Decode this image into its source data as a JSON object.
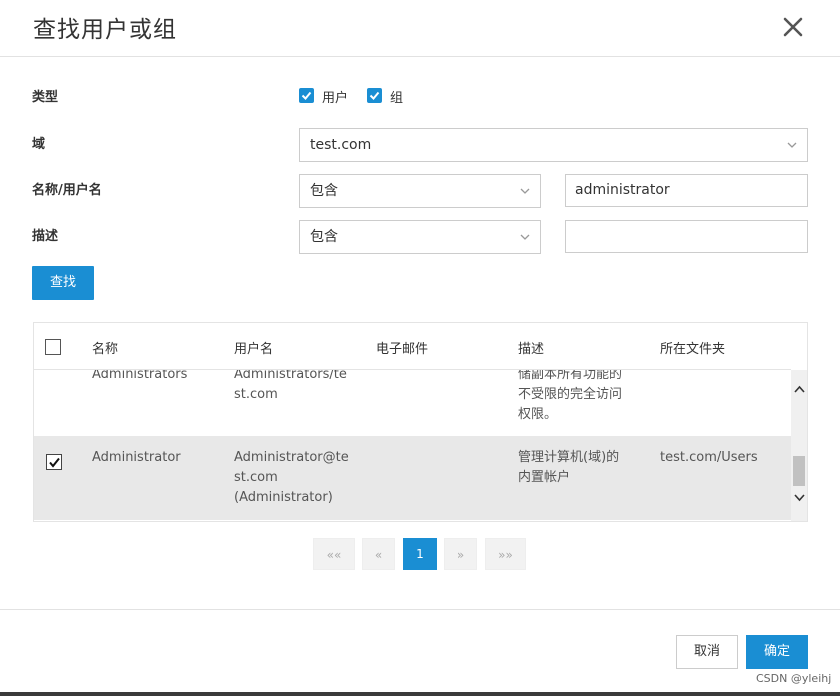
{
  "dialog": {
    "title": "查找用户或组"
  },
  "form": {
    "type_label": "类型",
    "type_options": [
      {
        "label": "用户",
        "checked": true
      },
      {
        "label": "组",
        "checked": true
      }
    ],
    "domain_label": "域",
    "domain_value": "test.com",
    "name_label": "名称/用户名",
    "name_operator": "包含",
    "name_value": "administrator",
    "desc_label": "描述",
    "desc_operator": "包含",
    "desc_value": "",
    "search_button": "查找"
  },
  "table": {
    "columns": [
      "名称",
      "用户名",
      "电子邮件",
      "描述",
      "所在文件夹"
    ],
    "rows": [
      {
        "checked": false,
        "name": "Administrators",
        "username": "Administrators/te\nst.com",
        "email": "",
        "description": "储副本所有功能的\n不受限的完全访问\n权限。",
        "folder": ""
      },
      {
        "checked": true,
        "name": "Administrator",
        "username": "Administrator@te\nst.com\n(Administrator)",
        "email": "",
        "description": "管理计算机(域)的\n内置帐户",
        "folder": "test.com/Users"
      }
    ]
  },
  "pagination": {
    "first": "««",
    "prev": "«",
    "current": "1",
    "next": "»",
    "last": "»»"
  },
  "footer": {
    "cancel_label": "取消",
    "ok_label": "确定"
  },
  "watermark": "CSDN @yleihj",
  "colors": {
    "accent": "#1a8ed3",
    "selected_row": "#e8e8e8"
  }
}
